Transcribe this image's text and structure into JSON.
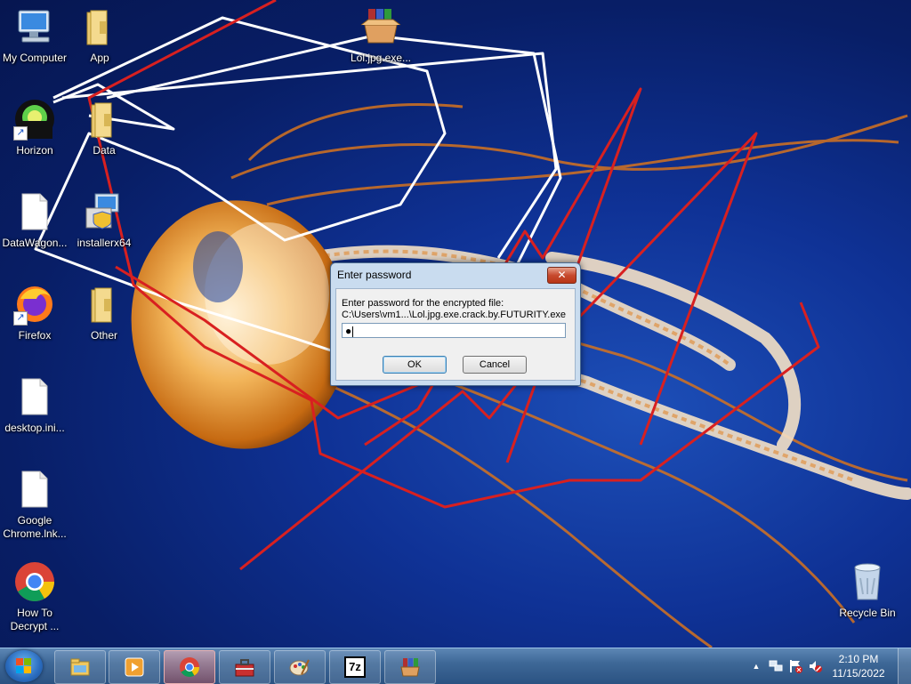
{
  "desktop_icons": [
    {
      "label": "My Computer",
      "icon": "computer-icon"
    },
    {
      "label": "App",
      "icon": "folder-icon"
    },
    {
      "label": "Lol.jpg.exe...",
      "icon": "winrar-archive-icon"
    },
    {
      "label": "Horizon",
      "icon": "horizon-icon"
    },
    {
      "label": "Data",
      "icon": "folder-icon"
    },
    {
      "label": "DataWagon...",
      "icon": "blank-file-icon"
    },
    {
      "label": "installerx64",
      "icon": "installer-icon"
    },
    {
      "label": "Firefox",
      "icon": "firefox-icon"
    },
    {
      "label": "Other",
      "icon": "folder-icon"
    },
    {
      "label": "desktop.ini...",
      "icon": "blank-file-icon"
    },
    {
      "label": "Google Chrome.lnk...",
      "icon": "blank-file-icon"
    },
    {
      "label": "How To Decrypt ...",
      "icon": "chrome-icon"
    },
    {
      "label": "Recycle Bin",
      "icon": "recycle-bin-icon"
    }
  ],
  "dialog": {
    "title": "Enter password",
    "close_label": "✕",
    "prompt_line1": "Enter password for the encrypted file:",
    "prompt_line2": "C:\\Users\\vm1...\\Lol.jpg.exe.crack.by.FUTURITY.exe",
    "password_value": "●",
    "ok_label": "OK",
    "cancel_label": "Cancel"
  },
  "taskbar": {
    "items": [
      {
        "icon": "explorer-icon",
        "active": false
      },
      {
        "icon": "media-player-icon",
        "active": false
      },
      {
        "icon": "chrome-icon",
        "active": true
      },
      {
        "icon": "toolbox-icon",
        "active": false
      },
      {
        "icon": "paint-icon",
        "active": false
      },
      {
        "icon": "7zip-icon",
        "label": "7z",
        "active": false
      },
      {
        "icon": "winrar-icon",
        "active": false
      }
    ],
    "tray": {
      "show_hidden_label": "▲",
      "time": "2:10 PM",
      "date": "11/15/2022"
    }
  },
  "colors": {
    "wallpaper_blue": "#0f3296",
    "close_red": "#c74a2e",
    "taskbar": "#3e6897"
  }
}
